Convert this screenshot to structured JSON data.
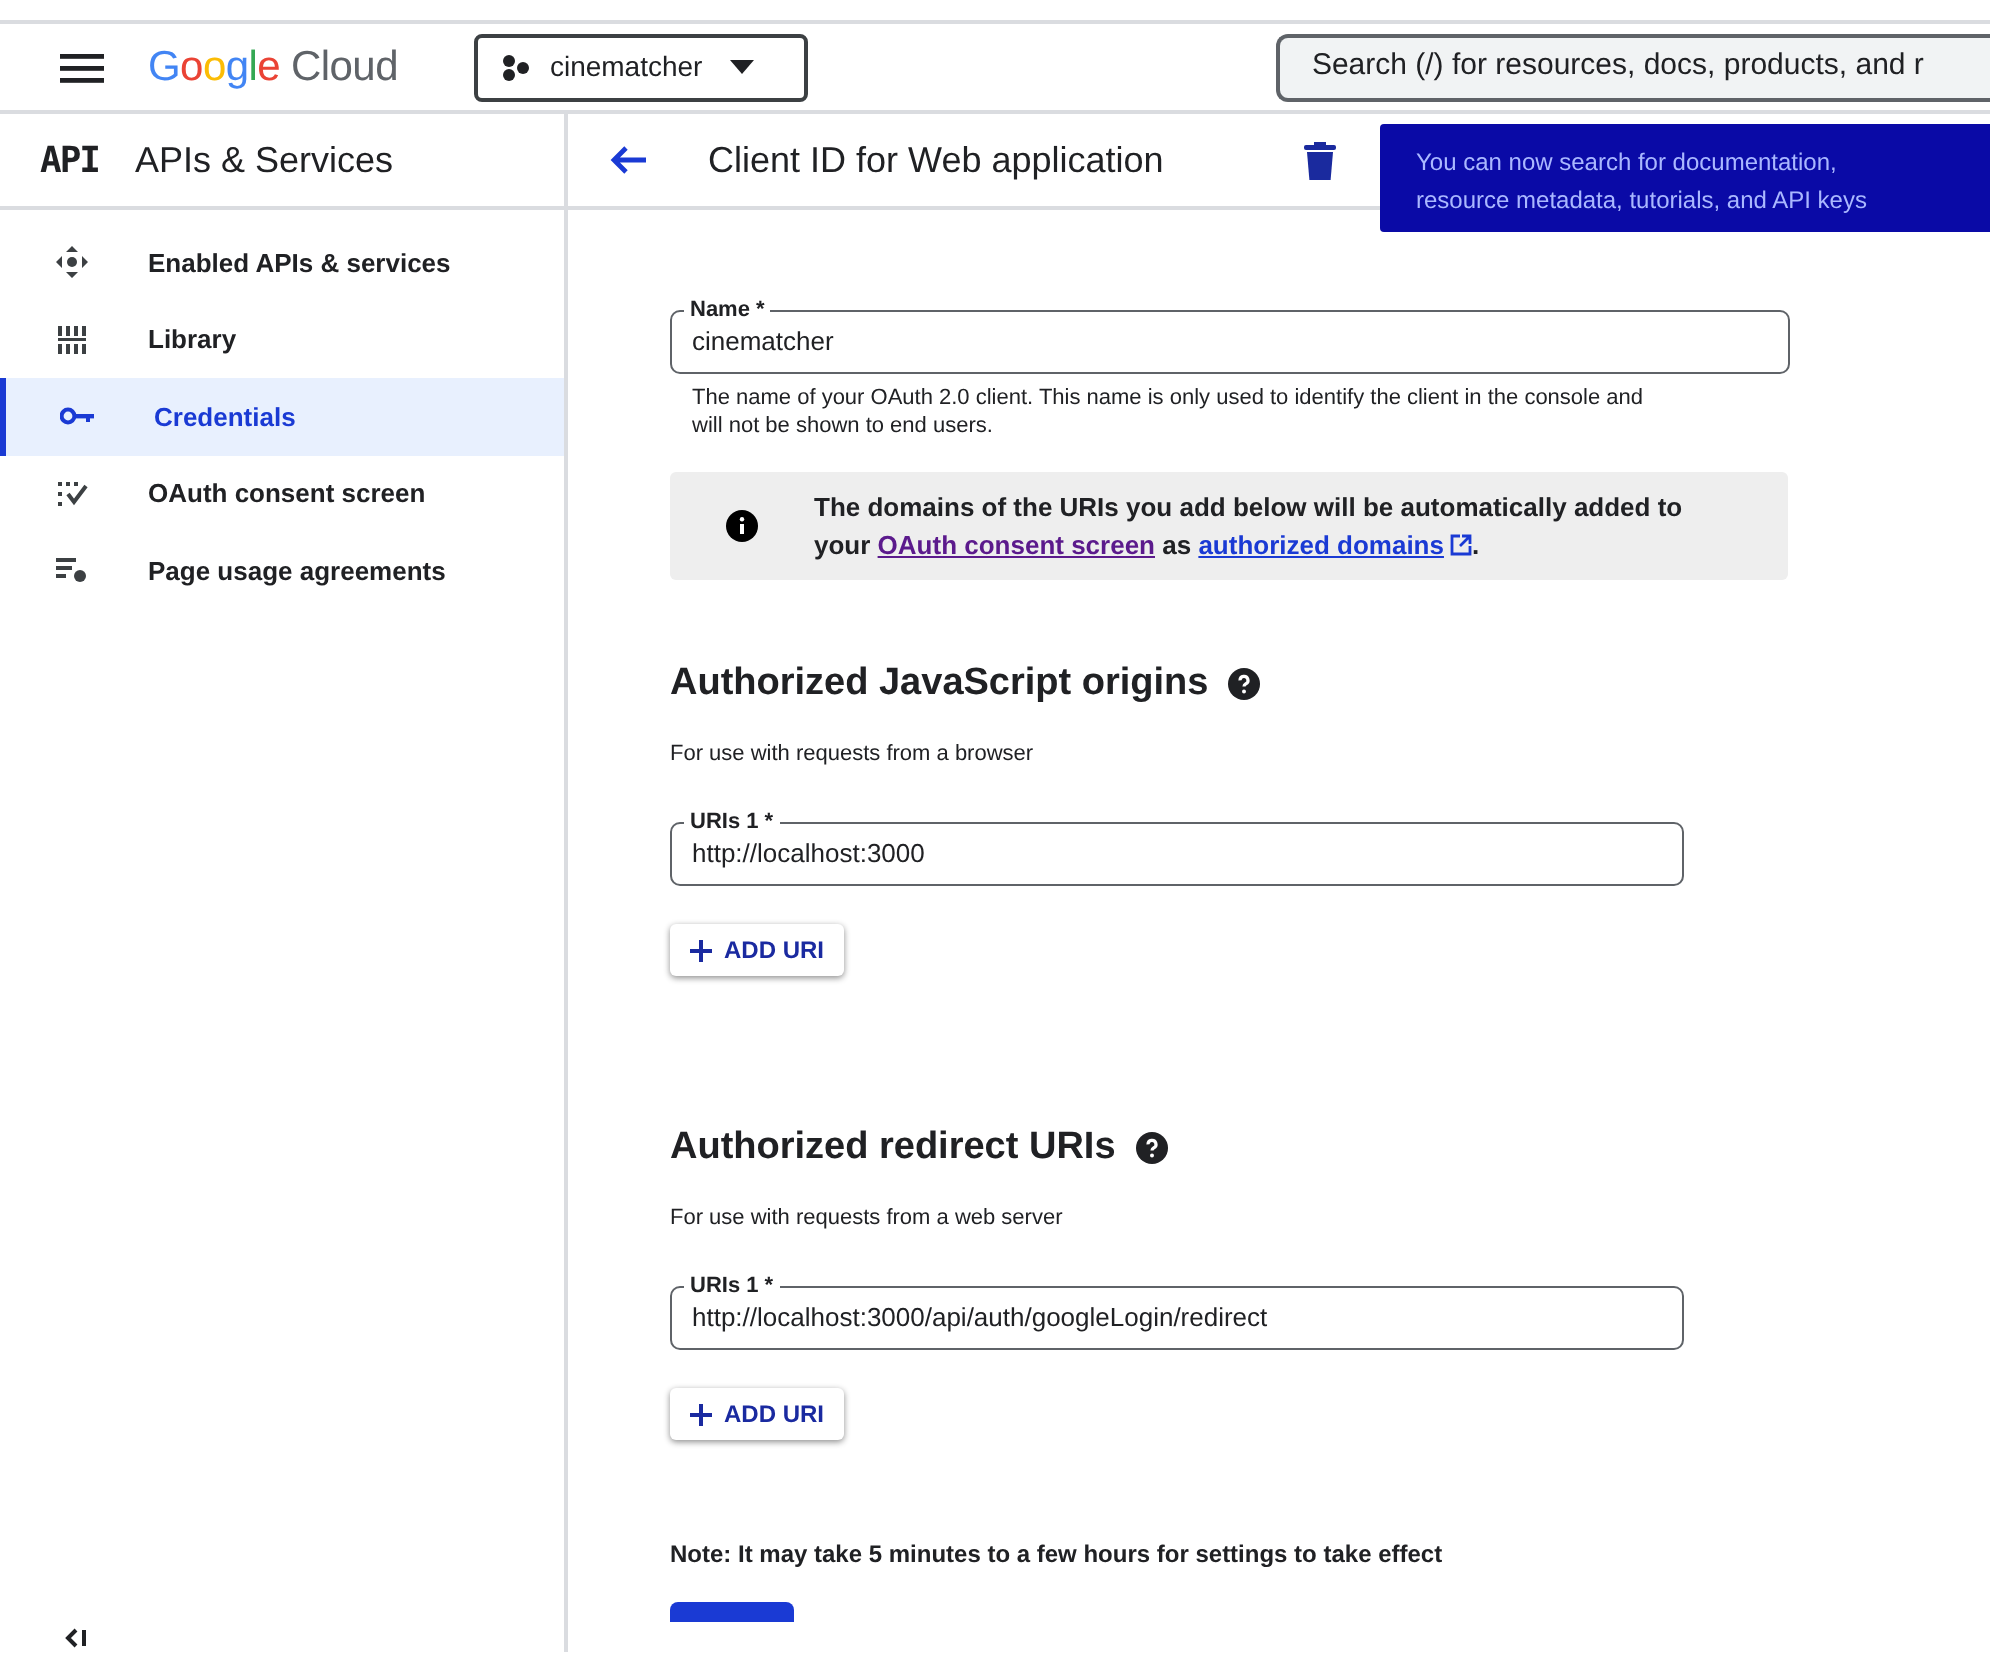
{
  "header": {
    "logo": "Google Cloud",
    "project": "cinematcher",
    "search": {
      "placeholder": "Search (/) for resources, docs, products, and r"
    }
  },
  "sidebar": {
    "badge": "API",
    "title": "APIs & Services",
    "items": [
      {
        "label": "Enabled APIs & services",
        "selected": false
      },
      {
        "label": "Library",
        "selected": false
      },
      {
        "label": "Credentials",
        "selected": true
      },
      {
        "label": "OAuth consent screen",
        "selected": false
      },
      {
        "label": "Page usage agreements",
        "selected": false
      }
    ]
  },
  "page": {
    "title": "Client ID for Web application"
  },
  "tooltip": {
    "text": "You can now search for documentation, resource metadata, tutorials, and API keys"
  },
  "name_field": {
    "label": "Name *",
    "value": "cinematcher",
    "hint": "The name of your OAuth 2.0 client. This name is only used to identify the client in the console and will not be shown to end users."
  },
  "info": {
    "parts": [
      {
        "kind": "text",
        "text": "The domains of the URIs you add below will be automatically added to your "
      },
      {
        "kind": "link",
        "text": "OAuth consent screen",
        "visited": true
      },
      {
        "kind": "text",
        "text": " as "
      },
      {
        "kind": "link",
        "text": "authorized domains",
        "visited": false,
        "external": true
      },
      {
        "kind": "text",
        "text": "."
      }
    ]
  },
  "sections": [
    {
      "title": "Authorized JavaScript origins",
      "subtitle": "For use with requests from a browser",
      "uris": [
        {
          "label": "URIs 1 *",
          "value": "http://localhost:3000"
        }
      ],
      "add_button": "ADD URI"
    },
    {
      "title": "Authorized redirect URIs",
      "subtitle": "For use with requests from a web server",
      "uris": [
        {
          "label": "URIs 1 *",
          "value": "http://localhost:3000/api/auth/googleLogin/redirect"
        }
      ],
      "add_button": "ADD URI"
    }
  ],
  "note": "Note: It may take 5 minutes to a few hours for settings to take effect"
}
